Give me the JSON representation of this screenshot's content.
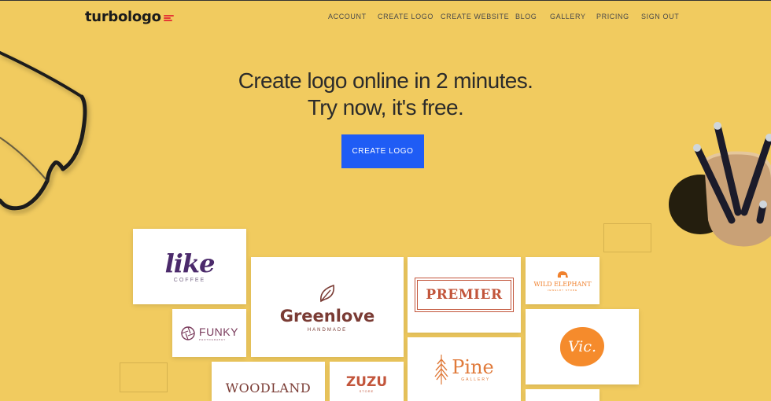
{
  "brand": {
    "name": "turbologo"
  },
  "nav": {
    "items": [
      "ACCOUNT",
      "CREATE LOGO",
      "CREATE WEBSITE",
      "BLOG",
      "GALLERY",
      "PRICING",
      "SIGN OUT"
    ]
  },
  "hero": {
    "line1": "Create logo online in 2 minutes.",
    "line2": "Try now, it's free.",
    "cta_label": "CREATE LOGO"
  },
  "gallery": {
    "like": {
      "title": "like",
      "sub": "COFFEE"
    },
    "greenlove": {
      "title": "Greenlove",
      "sub": "HANDMADE"
    },
    "premier": {
      "title": "PREMIER"
    },
    "wild_elephant": {
      "title": "WILD ELEPHANT",
      "sub": "JEWELRY STORE"
    },
    "funky": {
      "title": "FUNKY",
      "sub": "PHOTOGRAPHY"
    },
    "vic": {
      "title": "Vic."
    },
    "pine": {
      "title": "Pine",
      "sub": "GALLERY"
    },
    "woodland": {
      "title": "WOODLAND"
    },
    "zuzu": {
      "title": "ZUZU",
      "sub": "STORE"
    }
  },
  "colors": {
    "background": "#f1cb5f",
    "cta": "#1f5cf5",
    "brand_accent": "#e53935",
    "like_purple": "#4b2a6b",
    "greenlove_brown": "#7a3b34",
    "orange": "#f0812d"
  }
}
